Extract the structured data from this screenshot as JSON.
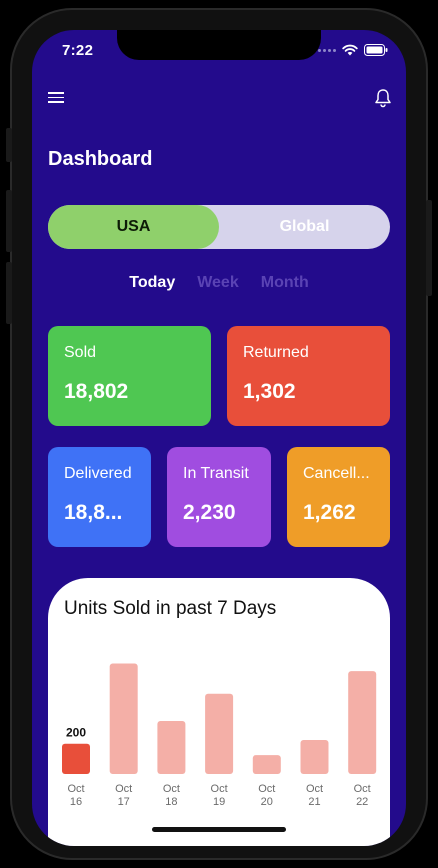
{
  "status_bar": {
    "time": "7:22"
  },
  "header": {
    "menu_icon": "hamburger-menu-icon",
    "bell_icon": "bell-icon"
  },
  "page": {
    "title": "Dashboard"
  },
  "region_toggle": {
    "selected": "USA",
    "other": "Global"
  },
  "period_tabs": [
    {
      "label": "Today",
      "active": true
    },
    {
      "label": "Week",
      "active": false
    },
    {
      "label": "Month",
      "active": false
    }
  ],
  "stats": {
    "sold": {
      "label": "Sold",
      "value": "18,802",
      "color": "#4FC752"
    },
    "returned": {
      "label": "Returned",
      "value": "1,302",
      "color": "#E84F3A"
    },
    "delivered": {
      "label": "Delivered",
      "value": "18,8...",
      "color": "#3F72F6"
    },
    "in_transit": {
      "label": "In Transit",
      "value": "2,230",
      "color": "#A04DE0"
    },
    "cancelled": {
      "label": "Cancell...",
      "value": "1,262",
      "color": "#EF9D28"
    }
  },
  "colors": {
    "background": "#230B8C",
    "bar_highlight": "#E84F3A",
    "bar_default": "#F4AFA7"
  },
  "chart_data": {
    "type": "bar",
    "title": "Units Sold in past 7 Days",
    "categories": [
      "Oct 16",
      "Oct 17",
      "Oct 18",
      "Oct 19",
      "Oct 20",
      "Oct 21",
      "Oct 22"
    ],
    "values": [
      200,
      730,
      350,
      530,
      125,
      225,
      680
    ],
    "highlight_index": 0,
    "data_labels": [
      "200",
      "",
      "",
      "",
      "",
      "",
      ""
    ],
    "ylim": [
      0,
      760
    ],
    "grid": false
  }
}
